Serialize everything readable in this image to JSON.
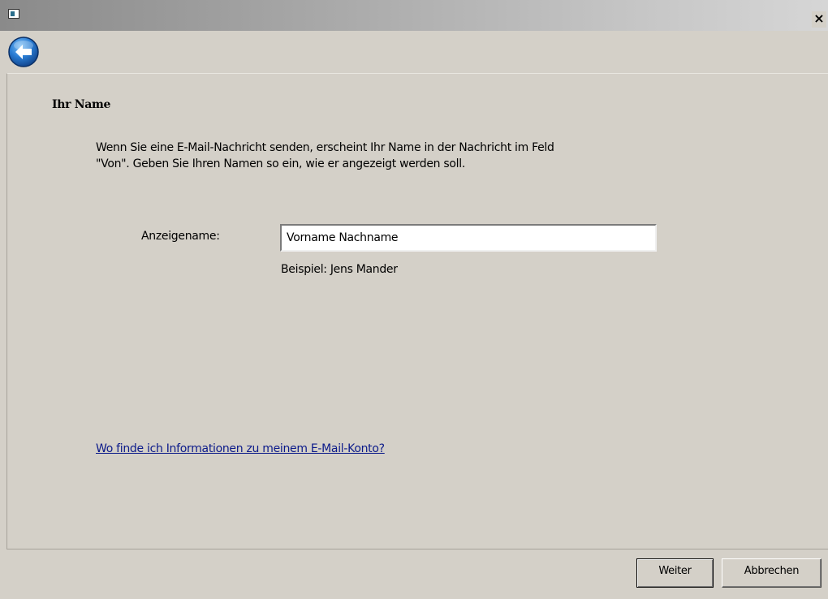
{
  "window": {
    "close_glyph": "×"
  },
  "page": {
    "heading": "Ihr Name",
    "description_line1": "Wenn Sie eine E-Mail-Nachricht senden, erscheint Ihr Name in der Nachricht im Feld",
    "description_line2": "\"Von\". Geben Sie Ihren Namen so ein, wie er angezeigt werden soll."
  },
  "form": {
    "display_name_label": "Anzeigename:",
    "display_name_value": "Vorname Nachname",
    "example_text": "Beispiel: Jens Mander"
  },
  "help": {
    "link_text": "Wo finde ich Informationen zu meinem E-Mail-Konto?"
  },
  "buttons": {
    "next_label": "Weiter",
    "cancel_label": "Abbrechen"
  },
  "colors": {
    "window_bg": "#d4d0c8",
    "link": "#0b1a8a",
    "back_button": "#1f6fc4"
  },
  "icons": {
    "app": "app-icon",
    "close": "close-icon",
    "back": "back-arrow-icon"
  }
}
